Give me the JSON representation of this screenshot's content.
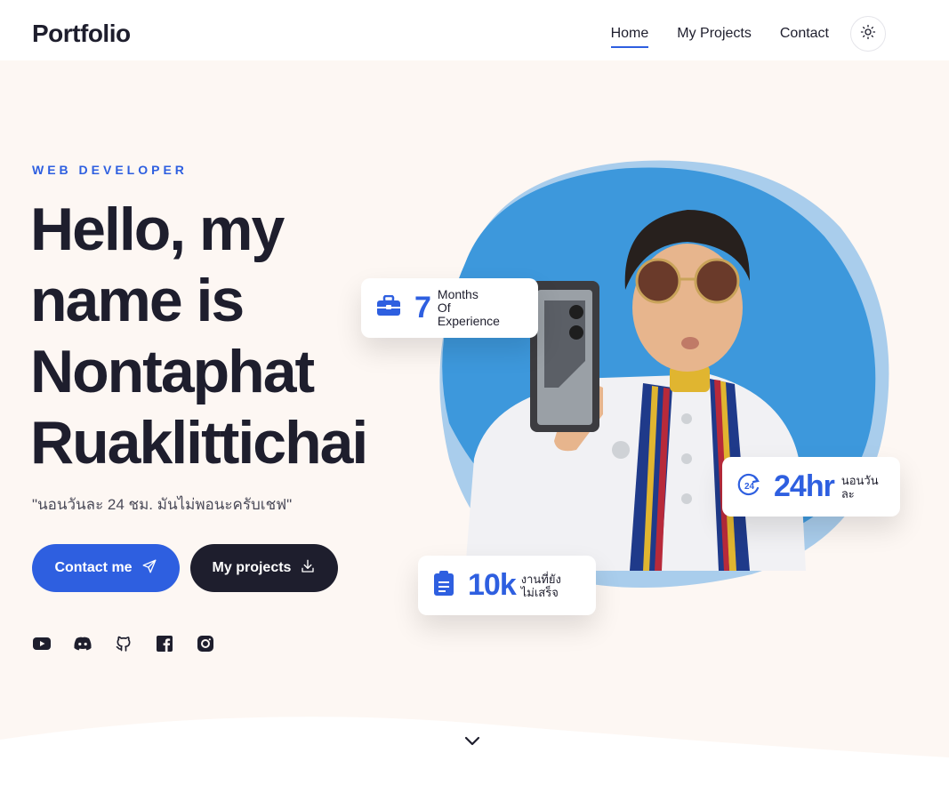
{
  "header": {
    "logo": "Portfolio",
    "nav": [
      {
        "label": "Home",
        "active": true
      },
      {
        "label": "My Projects",
        "active": false
      },
      {
        "label": "Contact",
        "active": false
      }
    ],
    "theme_toggle_icon": "sun-icon"
  },
  "hero": {
    "role": "WEB DEVELOPER",
    "headline_lines": [
      "Hello, my",
      "name is",
      "Nontaphat",
      "Ruaklittichai"
    ],
    "quote": "\"นอนวันละ 24 ชม. มันไม่พอนะครับเชฟ\"",
    "buttons": {
      "contact": {
        "label": "Contact me",
        "icon": "send-icon"
      },
      "projects": {
        "label": "My projects",
        "icon": "download-icon"
      }
    },
    "socials": [
      "youtube-icon",
      "discord-icon",
      "github-icon",
      "facebook-icon",
      "instagram-icon"
    ]
  },
  "stats": {
    "experience": {
      "value": "7",
      "label_lines": [
        "Months",
        "Of",
        "Experience"
      ],
      "icon": "briefcase-icon"
    },
    "hours": {
      "value": "24hr",
      "label_lines": [
        "นอนวัน",
        "ละ"
      ],
      "icon": "clock-24-icon"
    },
    "todo": {
      "value": "10k",
      "label_lines": [
        "งานที่ยัง",
        "ไม่เสร็จ"
      ],
      "icon": "clipboard-icon"
    }
  },
  "colors": {
    "accent": "#2e5fe0",
    "dark": "#1e1e2d",
    "hero_bg": "#fdf7f3",
    "blob": "#3d98dc",
    "blob_light": "#a9cdec"
  }
}
